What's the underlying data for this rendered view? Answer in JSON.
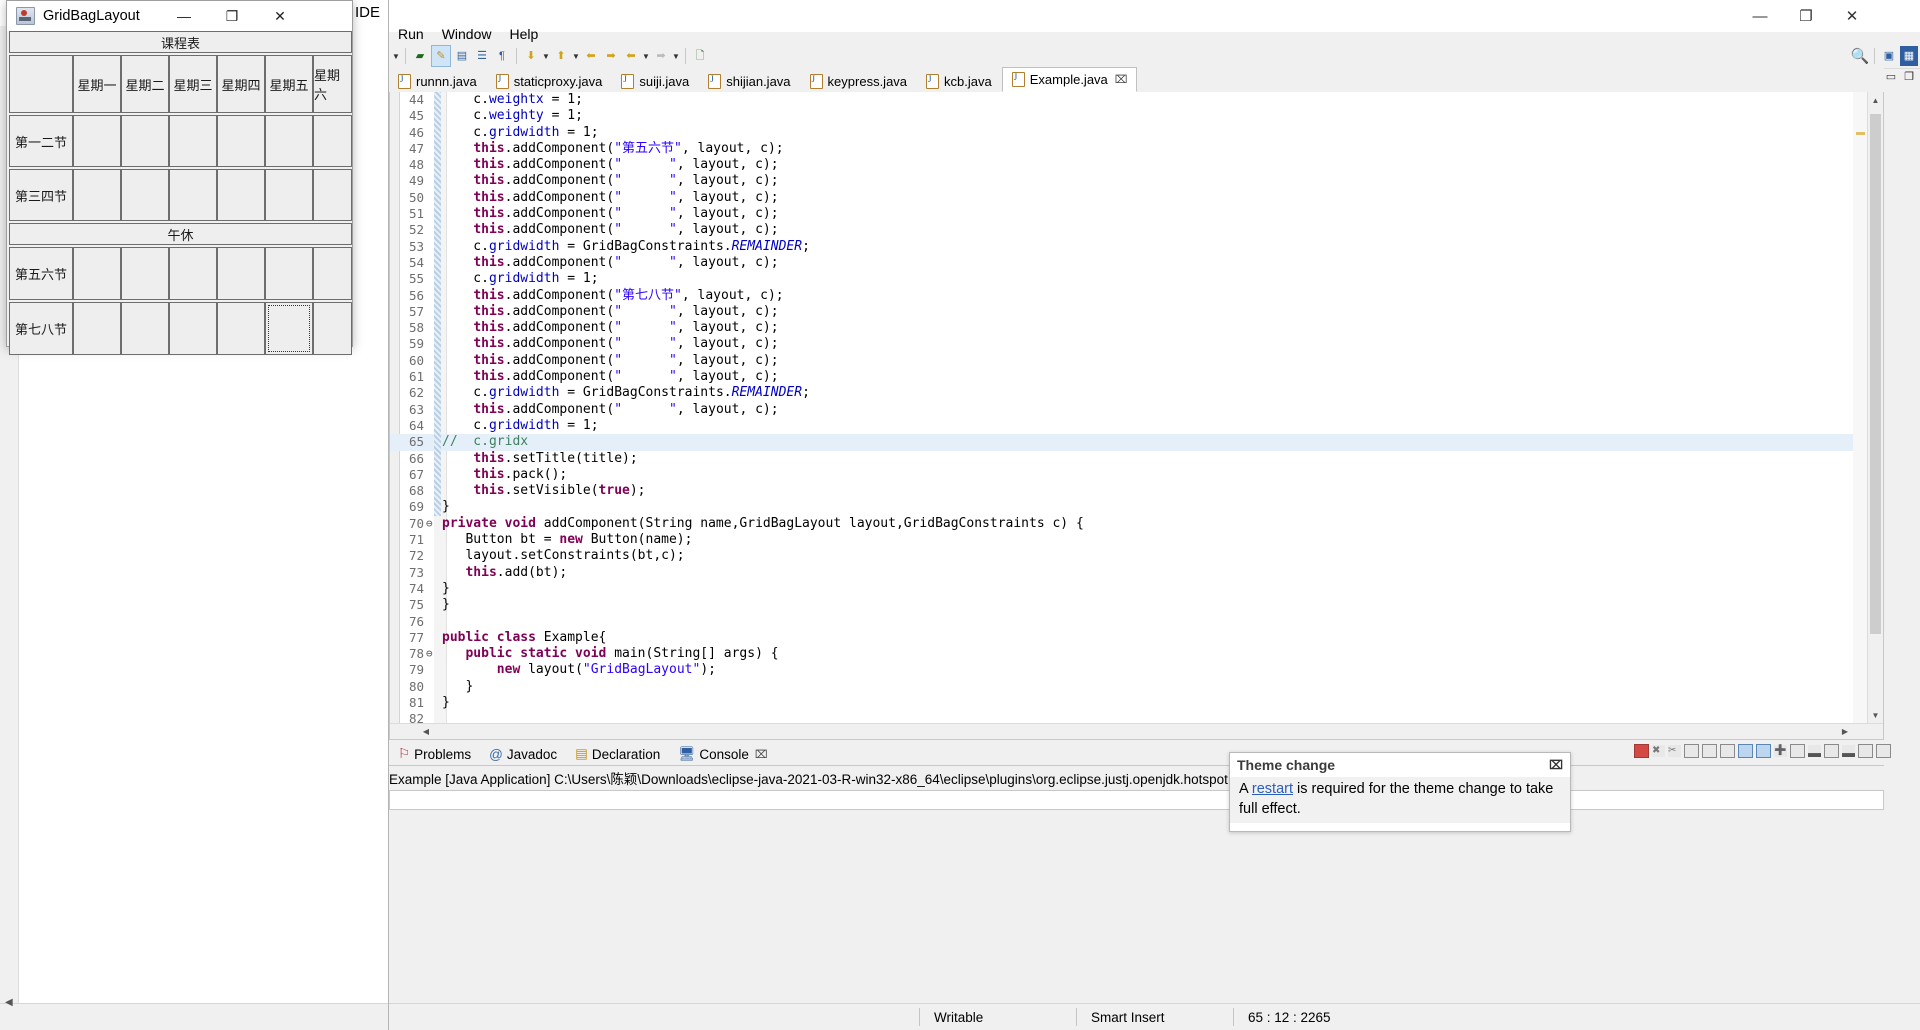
{
  "ide": {
    "title": "IDE",
    "window_controls": {
      "minimize": "—",
      "maximize": "❐",
      "close": "✕"
    },
    "menus": [
      "Run",
      "Window",
      "Help"
    ],
    "tabs": [
      {
        "label": "runnn.java",
        "active": false
      },
      {
        "label": "staticproxy.java",
        "active": false
      },
      {
        "label": "suiji.java",
        "active": false
      },
      {
        "label": "shijian.java",
        "active": false
      },
      {
        "label": "keypress.java",
        "active": false
      },
      {
        "label": "kcb.java",
        "active": false
      },
      {
        "label": "Example.java",
        "active": true,
        "close": "⌧"
      }
    ],
    "bottom_tabs": [
      {
        "label": "Problems",
        "icon": "problems-icon",
        "active": false
      },
      {
        "label": "Javadoc",
        "icon": "javadoc-icon",
        "active": false
      },
      {
        "label": "Declaration",
        "icon": "declaration-icon",
        "active": false
      },
      {
        "label": "Console",
        "icon": "console-icon",
        "active": true,
        "close": "⌧"
      }
    ],
    "console_line": "Example [Java Application] C:\\Users\\陈颖\\Downloads\\eclipse-java-2021-03-R-win32-x86_64\\eclipse\\plugins\\org.eclipse.justj.openjdk.hotspot.jre",
    "statusbar": {
      "writable": "Writable",
      "insert_mode": "Smart Insert",
      "position": "65 : 12 : 2265"
    },
    "search_icon": "search-icon"
  },
  "theme_popup": {
    "title": "Theme change",
    "close": "⌧",
    "text_before": "A ",
    "link": "restart",
    "text_after": " is required for the theme change to take full effect."
  },
  "code": {
    "lines": [
      {
        "n": "44",
        "fold": "",
        "hl": false,
        "html": "    c.<span class=\"fld\">weightx</span> = <span>1</span>;"
      },
      {
        "n": "45",
        "fold": "",
        "hl": false,
        "html": "    c.<span class=\"fld\">weighty</span> = 1;"
      },
      {
        "n": "46",
        "fold": "",
        "hl": false,
        "html": "    c.<span class=\"fld\">gridwidth</span> = 1;"
      },
      {
        "n": "47",
        "fold": "",
        "hl": false,
        "html": "    <span class=\"kw\">this</span>.addComponent(<span class=\"str\">\"第五六节\"</span>, layout, c);"
      },
      {
        "n": "48",
        "fold": "",
        "hl": false,
        "html": "    <span class=\"kw\">this</span>.addComponent(<span class=\"str\">\"      \"</span>, layout, c);"
      },
      {
        "n": "49",
        "fold": "",
        "hl": false,
        "html": "    <span class=\"kw\">this</span>.addComponent(<span class=\"str\">\"      \"</span>, layout, c);"
      },
      {
        "n": "50",
        "fold": "",
        "hl": false,
        "html": "    <span class=\"kw\">this</span>.addComponent(<span class=\"str\">\"      \"</span>, layout, c);"
      },
      {
        "n": "51",
        "fold": "",
        "hl": false,
        "html": "    <span class=\"kw\">this</span>.addComponent(<span class=\"str\">\"      \"</span>, layout, c);"
      },
      {
        "n": "52",
        "fold": "",
        "hl": false,
        "html": "    <span class=\"kw\">this</span>.addComponent(<span class=\"str\">\"      \"</span>, layout, c);"
      },
      {
        "n": "53",
        "fold": "",
        "hl": false,
        "html": "    c.<span class=\"fld\">gridwidth</span> = GridBagConstraints.<span class=\"stc\">REMAINDER</span>;"
      },
      {
        "n": "54",
        "fold": "",
        "hl": false,
        "html": "    <span class=\"kw\">this</span>.addComponent(<span class=\"str\">\"      \"</span>, layout, c);"
      },
      {
        "n": "55",
        "fold": "",
        "hl": false,
        "html": "    c.<span class=\"fld\">gridwidth</span> = 1;"
      },
      {
        "n": "56",
        "fold": "",
        "hl": false,
        "html": "    <span class=\"kw\">this</span>.addComponent(<span class=\"str\">\"第七八节\"</span>, layout, c);"
      },
      {
        "n": "57",
        "fold": "",
        "hl": false,
        "html": "    <span class=\"kw\">this</span>.addComponent(<span class=\"str\">\"      \"</span>, layout, c);"
      },
      {
        "n": "58",
        "fold": "",
        "hl": false,
        "html": "    <span class=\"kw\">this</span>.addComponent(<span class=\"str\">\"      \"</span>, layout, c);"
      },
      {
        "n": "59",
        "fold": "",
        "hl": false,
        "html": "    <span class=\"kw\">this</span>.addComponent(<span class=\"str\">\"      \"</span>, layout, c);"
      },
      {
        "n": "60",
        "fold": "",
        "hl": false,
        "html": "    <span class=\"kw\">this</span>.addComponent(<span class=\"str\">\"      \"</span>, layout, c);"
      },
      {
        "n": "61",
        "fold": "",
        "hl": false,
        "html": "    <span class=\"kw\">this</span>.addComponent(<span class=\"str\">\"      \"</span>, layout, c);"
      },
      {
        "n": "62",
        "fold": "",
        "hl": false,
        "html": "    c.<span class=\"fld\">gridwidth</span> = GridBagConstraints.<span class=\"stc\">REMAINDER</span>;"
      },
      {
        "n": "63",
        "fold": "",
        "hl": false,
        "html": "    <span class=\"kw\">this</span>.addComponent(<span class=\"str\">\"      \"</span>, layout, c);"
      },
      {
        "n": "64",
        "fold": "",
        "hl": false,
        "html": "    c.<span class=\"fld\">gridwidth</span> = 1;"
      },
      {
        "n": "65",
        "fold": "",
        "hl": true,
        "html": "<span class=\"cmt\">//  c.gridx</span>"
      },
      {
        "n": "66",
        "fold": "",
        "hl": false,
        "html": "    <span class=\"kw\">this</span>.setTitle(title);"
      },
      {
        "n": "67",
        "fold": "",
        "hl": false,
        "html": "    <span class=\"kw\">this</span>.pack();"
      },
      {
        "n": "68",
        "fold": "",
        "hl": false,
        "html": "    <span class=\"kw\">this</span>.setVisible(<span class=\"kw\">true</span>);"
      },
      {
        "n": "69",
        "fold": "",
        "hl": false,
        "html": "}"
      },
      {
        "n": "70",
        "fold": "⊖",
        "hl": false,
        "html": "<span class=\"kw\">private void</span> addComponent(String name,GridBagLayout layout,GridBagConstraints c) {"
      },
      {
        "n": "71",
        "fold": "",
        "hl": false,
        "html": "   Button bt = <span class=\"kw\">new</span> Button(name);"
      },
      {
        "n": "72",
        "fold": "",
        "hl": false,
        "html": "   layout.setConstraints(bt,c);"
      },
      {
        "n": "73",
        "fold": "",
        "hl": false,
        "html": "   <span class=\"kw\">this</span>.add(bt);"
      },
      {
        "n": "74",
        "fold": "",
        "hl": false,
        "html": "}"
      },
      {
        "n": "75",
        "fold": "",
        "hl": false,
        "html": "}"
      },
      {
        "n": "76",
        "fold": "",
        "hl": false,
        "html": ""
      },
      {
        "n": "77",
        "fold": "",
        "hl": false,
        "html": "<span class=\"kw\">public class</span> Example{"
      },
      {
        "n": "78",
        "fold": "⊖",
        "hl": false,
        "html": "   <span class=\"kw\">public static void</span> main(String[] args) {"
      },
      {
        "n": "79",
        "fold": "",
        "hl": false,
        "html": "       <span class=\"kw\">new</span> layout(<span class=\"str\">\"GridBagLayout\"</span>);"
      },
      {
        "n": "80",
        "fold": "",
        "hl": false,
        "html": "   }"
      },
      {
        "n": "81",
        "fold": "",
        "hl": false,
        "html": "}"
      },
      {
        "n": "82",
        "fold": "",
        "hl": false,
        "html": ""
      }
    ]
  },
  "swing": {
    "title": "GridBagLayout",
    "icon": "java-app-icon",
    "controls": {
      "minimize": "—",
      "maximize": "❐",
      "close": "✕"
    },
    "header_label": "课程表",
    "break_label": "午休",
    "corner_label": "",
    "days": [
      "星期一",
      "星期二",
      "星期三",
      "星期四",
      "星期五",
      "星期六"
    ],
    "periods_top": [
      "第一二节",
      "第三四节"
    ],
    "periods_bottom": [
      "第五六节",
      "第七八节"
    ],
    "focused_cell": {
      "row": "第七八节",
      "col": "星期五"
    }
  }
}
